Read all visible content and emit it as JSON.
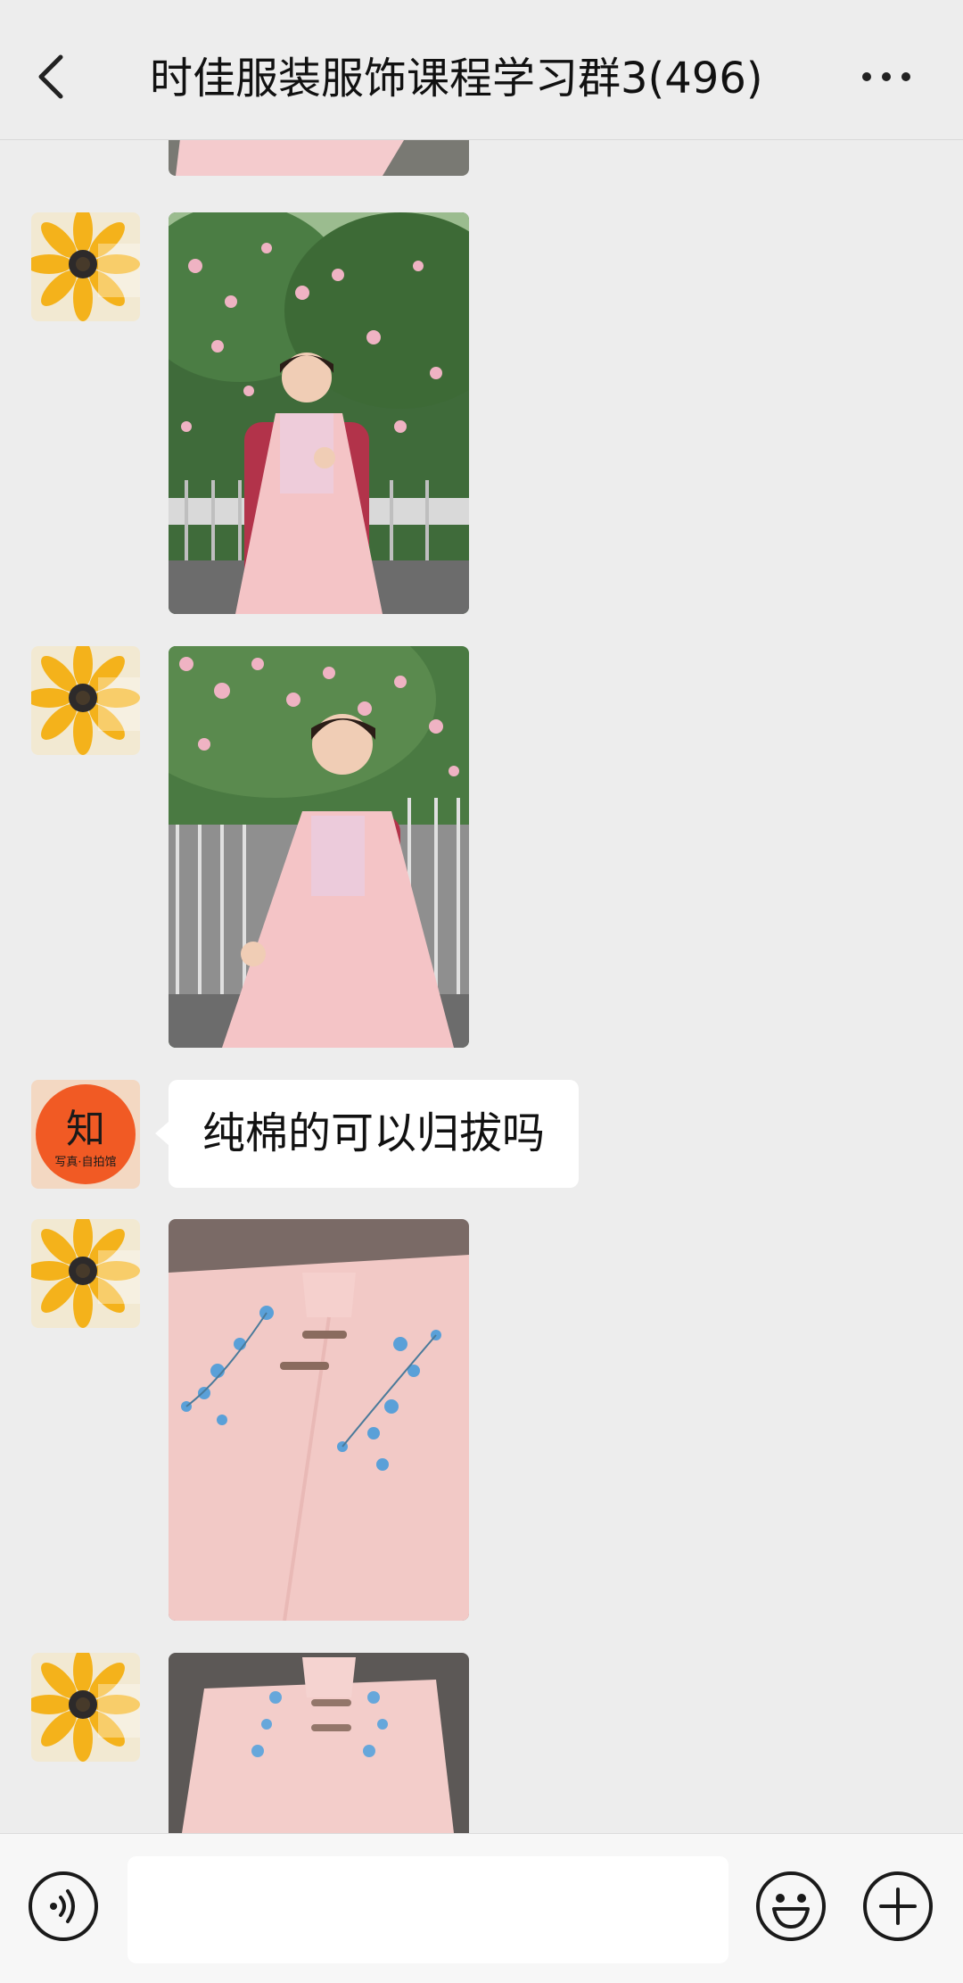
{
  "header": {
    "title": "时佳服装服饰课程学习群3(496)",
    "back_icon": "chevron-left-icon",
    "more_icon": "more-horizontal-icon"
  },
  "messages": [
    {
      "type": "image",
      "sender": "sunflower-avatar",
      "content": "girl-pink-dress-photo"
    },
    {
      "type": "image",
      "sender": "sunflower-avatar",
      "content": "girl-pink-dress-photo"
    },
    {
      "type": "image",
      "sender": "sunflower-avatar",
      "content": "girl-pink-dress-smiling-photo"
    },
    {
      "type": "text",
      "sender": "studio-logo-avatar",
      "text": "纯棉的可以归拔吗"
    },
    {
      "type": "image",
      "sender": "sunflower-avatar",
      "content": "pink-embroidered-dress-closeup-photo"
    },
    {
      "type": "image",
      "sender": "sunflower-avatar",
      "content": "pink-embroidered-dress-photo"
    }
  ],
  "avatars": {
    "studio_logo_text": "知",
    "studio_logo_subtext": "写真·自拍馆"
  },
  "input_bar": {
    "voice_icon": "voice-icon",
    "emoji_icon": "emoji-icon",
    "plus_icon": "plus-icon",
    "input_value": ""
  },
  "colors": {
    "background": "#ededed",
    "bubble": "#ffffff",
    "dress_pink": "#f4c4c6",
    "sweater_red": "#b2334a",
    "studio_orange": "#f15a24"
  }
}
